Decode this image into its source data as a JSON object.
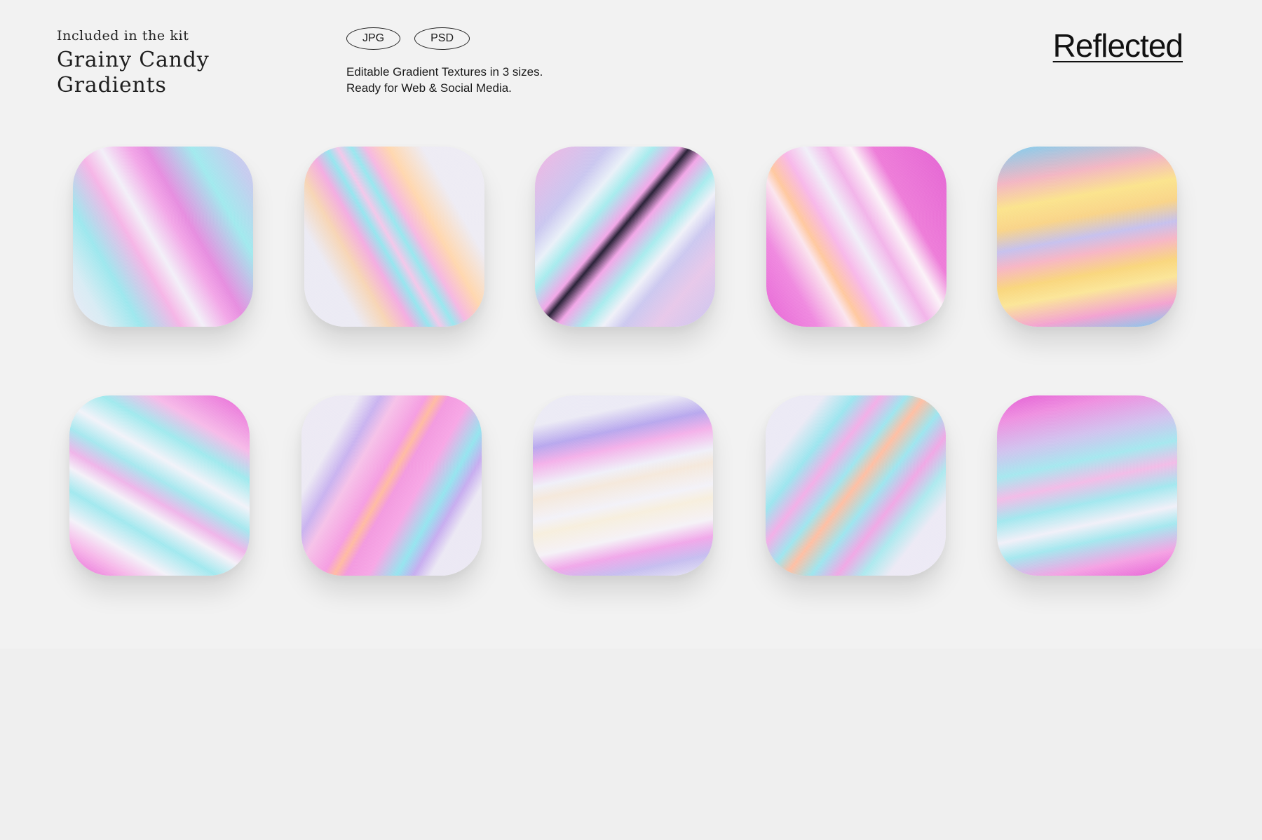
{
  "header": {
    "kit_label": "Included in the kit",
    "title": "Grainy Candy Gradients",
    "formats": [
      "JPG",
      "PSD"
    ],
    "description_line1": "Editable Gradient Textures in 3 sizes.",
    "description_line2": "Ready for Web & Social Media.",
    "style_name": "Reflected"
  },
  "tiles": [
    {
      "name": "gradient-tile-1",
      "colors": [
        "#9fe8ee",
        "#f6b6e7",
        "#e78fe0",
        "#d1cbef"
      ]
    },
    {
      "name": "gradient-tile-2",
      "colors": [
        "#ecebf4",
        "#f7d6b6",
        "#98e6ef",
        "#f4aee2"
      ]
    },
    {
      "name": "gradient-tile-3",
      "colors": [
        "#cbc7f0",
        "#a9ecee",
        "#f2a8e8",
        "#2a2238"
      ]
    },
    {
      "name": "gradient-tile-4",
      "colors": [
        "#e766d6",
        "#fbe6ee",
        "#ffc9a0",
        "#f1f0f8"
      ]
    },
    {
      "name": "gradient-tile-5",
      "colors": [
        "#7cccf0",
        "#fbe69a",
        "#f7b7c6",
        "#c7c2ee"
      ]
    },
    {
      "name": "gradient-tile-6",
      "colors": [
        "#e866d7",
        "#a3e9ef",
        "#f4f2f9",
        "#f0b6ea"
      ]
    },
    {
      "name": "gradient-tile-7",
      "colors": [
        "#ece9f4",
        "#97e5ef",
        "#f39ce0",
        "#ffbca3"
      ]
    },
    {
      "name": "gradient-tile-8",
      "colors": [
        "#ebeaf5",
        "#c7bff0",
        "#f1a9ea",
        "#f7efde"
      ]
    },
    {
      "name": "gradient-tile-9",
      "colors": [
        "#edeaf5",
        "#aeeaef",
        "#f1a9e6",
        "#ffc0a5"
      ]
    },
    {
      "name": "gradient-tile-10",
      "colors": [
        "#e760d6",
        "#a6e8ef",
        "#f1f0f8",
        "#d3c3ef"
      ]
    }
  ]
}
